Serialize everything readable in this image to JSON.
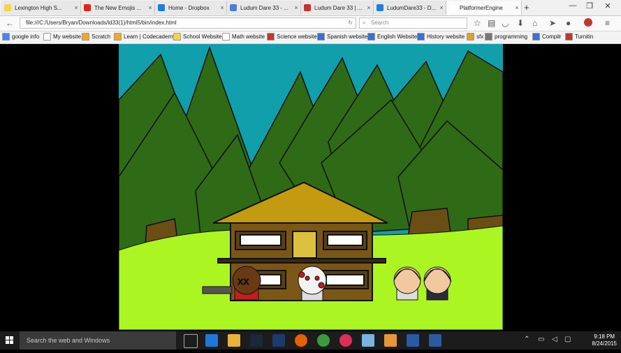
{
  "tabs": [
    {
      "label": "Lexington High S...",
      "color": "#f5d44c"
    },
    {
      "label": "The New Emojis ...",
      "color": "#e62117"
    },
    {
      "label": "Home - Dropbox",
      "color": "#1f7ee0"
    },
    {
      "label": "Ludum Dare 33 - ...",
      "color": "#4a7ed8"
    },
    {
      "label": "Ludum Dare 33 | ...",
      "color": "#c9302c"
    },
    {
      "label": "LudumDare33 - D...",
      "color": "#1f7ee0"
    },
    {
      "label": "PlatformerEngine",
      "color": "#ffffff"
    }
  ],
  "nav": {
    "url": "file:///C:/Users/Bryan/Downloads/ld33(1)/html5/bin/index.html",
    "search_placeholder": "Search"
  },
  "bookmarks": [
    {
      "label": "google info",
      "color": "#4285f4"
    },
    {
      "label": "My website",
      "color": "#ffffff"
    },
    {
      "label": "Scratch",
      "color": "#f5a623"
    },
    {
      "label": "Learn | Codecademy",
      "color": "#f5a623"
    },
    {
      "label": "School Website",
      "color": "#f5d44c"
    },
    {
      "label": "Math website",
      "color": "#ffffff"
    },
    {
      "label": "Science website",
      "color": "#c0392b"
    },
    {
      "label": "Spanish website",
      "color": "#3b6fd8"
    },
    {
      "label": "English Website",
      "color": "#3b6fd8"
    },
    {
      "label": "History website",
      "color": "#3b6fd8"
    },
    {
      "label": "sfx",
      "color": "#e0a020"
    },
    {
      "label": "programming",
      "color": "#777777"
    },
    {
      "label": "Compilr",
      "color": "#3b6fd8"
    },
    {
      "label": "Turnitin",
      "color": "#c0392b"
    }
  ],
  "taskbar": {
    "search_placeholder": "Search the web and Windows",
    "time": "9:18 PM",
    "date": "8/24/2015"
  },
  "game": {
    "sky": "#119fac",
    "ground": "#aaf522",
    "tree": "#2f6a16",
    "trunk": "#6a4e15",
    "house_wall": "#7b5715",
    "roof": "#c49a11",
    "door": "#dcc13f"
  }
}
